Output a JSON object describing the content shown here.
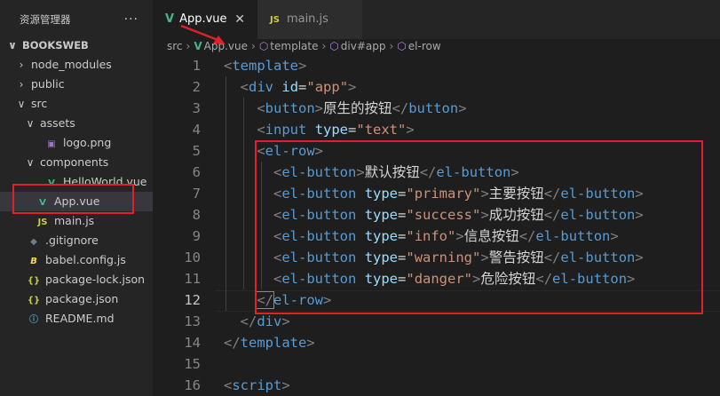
{
  "explorer": {
    "title": "资源管理器",
    "more": "···"
  },
  "tree": [
    {
      "label": "BOOKSWEB",
      "chevron": "∨",
      "icon": "",
      "depth": 0,
      "kind": "project"
    },
    {
      "label": "node_modules",
      "chevron": "›",
      "icon": "",
      "depth": 1,
      "kind": "folder"
    },
    {
      "label": "public",
      "chevron": "›",
      "icon": "",
      "depth": 1,
      "kind": "folder"
    },
    {
      "label": "src",
      "chevron": "∨",
      "icon": "",
      "depth": 1,
      "kind": "folder"
    },
    {
      "label": "assets",
      "chevron": "∨",
      "icon": "",
      "depth": 2,
      "kind": "folder"
    },
    {
      "label": "logo.png",
      "chevron": "",
      "icon": "▣",
      "depth": 3,
      "kind": "img"
    },
    {
      "label": "components",
      "chevron": "∨",
      "icon": "",
      "depth": 2,
      "kind": "folder"
    },
    {
      "label": "HelloWorld.vue",
      "chevron": "",
      "icon": "V",
      "depth": 3,
      "kind": "vue"
    },
    {
      "label": "App.vue",
      "chevron": "",
      "icon": "V",
      "depth": 2,
      "kind": "vue",
      "selected": true
    },
    {
      "label": "main.js",
      "chevron": "",
      "icon": "JS",
      "depth": 2,
      "kind": "js"
    },
    {
      "label": ".gitignore",
      "chevron": "",
      "icon": "◆",
      "depth": 1,
      "kind": "git"
    },
    {
      "label": "babel.config.js",
      "chevron": "",
      "icon": "B",
      "depth": 1,
      "kind": "babel"
    },
    {
      "label": "package-lock.json",
      "chevron": "",
      "icon": "{}",
      "depth": 1,
      "kind": "json"
    },
    {
      "label": "package.json",
      "chevron": "",
      "icon": "{}",
      "depth": 1,
      "kind": "json"
    },
    {
      "label": "README.md",
      "chevron": "",
      "icon": "ⓘ",
      "depth": 1,
      "kind": "info"
    }
  ],
  "tabs": [
    {
      "label": "App.vue",
      "icon": "V",
      "close": "✕"
    },
    {
      "label": "main.js",
      "icon": "JS"
    }
  ],
  "breadcrumb": [
    "src",
    "App.vue",
    "template",
    "div#app",
    "el-row"
  ],
  "breadcrumb_icons": [
    "",
    "V",
    "⬡",
    "⬡",
    "⬡"
  ],
  "code_lines": [
    {
      "n": "1",
      "tokens": [
        [
          "b",
          "<"
        ],
        [
          "t",
          "template"
        ],
        [
          "b",
          ">"
        ]
      ]
    },
    {
      "n": "2",
      "tokens": [
        [
          "tx",
          "  "
        ],
        [
          "b",
          "<"
        ],
        [
          "t",
          "div"
        ],
        [
          "tx",
          " "
        ],
        [
          "a",
          "id"
        ],
        [
          "tx",
          "="
        ],
        [
          "s",
          "\"app\""
        ],
        [
          "b",
          ">"
        ]
      ]
    },
    {
      "n": "3",
      "tokens": [
        [
          "tx",
          "    "
        ],
        [
          "b",
          "<"
        ],
        [
          "t",
          "button"
        ],
        [
          "b",
          ">"
        ],
        [
          "tx",
          "原生的按钮"
        ],
        [
          "b",
          "</"
        ],
        [
          "t",
          "button"
        ],
        [
          "b",
          ">"
        ]
      ]
    },
    {
      "n": "4",
      "tokens": [
        [
          "tx",
          "    "
        ],
        [
          "b",
          "<"
        ],
        [
          "t",
          "input"
        ],
        [
          "tx",
          " "
        ],
        [
          "a",
          "type"
        ],
        [
          "tx",
          "="
        ],
        [
          "s",
          "\"text\""
        ],
        [
          "b",
          ">"
        ]
      ]
    },
    {
      "n": "5",
      "tokens": [
        [
          "tx",
          "    "
        ],
        [
          "b",
          "<"
        ],
        [
          "t",
          "el-row"
        ],
        [
          "b",
          ">"
        ]
      ]
    },
    {
      "n": "6",
      "tokens": [
        [
          "tx",
          "      "
        ],
        [
          "b",
          "<"
        ],
        [
          "t",
          "el-button"
        ],
        [
          "b",
          ">"
        ],
        [
          "tx",
          "默认按钮"
        ],
        [
          "b",
          "</"
        ],
        [
          "t",
          "el-button"
        ],
        [
          "b",
          ">"
        ]
      ]
    },
    {
      "n": "7",
      "tokens": [
        [
          "tx",
          "      "
        ],
        [
          "b",
          "<"
        ],
        [
          "t",
          "el-button"
        ],
        [
          "tx",
          " "
        ],
        [
          "a",
          "type"
        ],
        [
          "tx",
          "="
        ],
        [
          "s",
          "\"primary\""
        ],
        [
          "b",
          ">"
        ],
        [
          "tx",
          "主要按钮"
        ],
        [
          "b",
          "</"
        ],
        [
          "t",
          "el-button"
        ],
        [
          "b",
          ">"
        ]
      ]
    },
    {
      "n": "8",
      "tokens": [
        [
          "tx",
          "      "
        ],
        [
          "b",
          "<"
        ],
        [
          "t",
          "el-button"
        ],
        [
          "tx",
          " "
        ],
        [
          "a",
          "type"
        ],
        [
          "tx",
          "="
        ],
        [
          "s",
          "\"success\""
        ],
        [
          "b",
          ">"
        ],
        [
          "tx",
          "成功按钮"
        ],
        [
          "b",
          "</"
        ],
        [
          "t",
          "el-button"
        ],
        [
          "b",
          ">"
        ]
      ]
    },
    {
      "n": "9",
      "tokens": [
        [
          "tx",
          "      "
        ],
        [
          "b",
          "<"
        ],
        [
          "t",
          "el-button"
        ],
        [
          "tx",
          " "
        ],
        [
          "a",
          "type"
        ],
        [
          "tx",
          "="
        ],
        [
          "s",
          "\"info\""
        ],
        [
          "b",
          ">"
        ],
        [
          "tx",
          "信息按钮"
        ],
        [
          "b",
          "</"
        ],
        [
          "t",
          "el-button"
        ],
        [
          "b",
          ">"
        ]
      ]
    },
    {
      "n": "10",
      "tokens": [
        [
          "tx",
          "      "
        ],
        [
          "b",
          "<"
        ],
        [
          "t",
          "el-button"
        ],
        [
          "tx",
          " "
        ],
        [
          "a",
          "type"
        ],
        [
          "tx",
          "="
        ],
        [
          "s",
          "\"warning\""
        ],
        [
          "b",
          ">"
        ],
        [
          "tx",
          "警告按钮"
        ],
        [
          "b",
          "</"
        ],
        [
          "t",
          "el-button"
        ],
        [
          "b",
          ">"
        ]
      ]
    },
    {
      "n": "11",
      "tokens": [
        [
          "tx",
          "      "
        ],
        [
          "b",
          "<"
        ],
        [
          "t",
          "el-button"
        ],
        [
          "tx",
          " "
        ],
        [
          "a",
          "type"
        ],
        [
          "tx",
          "="
        ],
        [
          "s",
          "\"danger\""
        ],
        [
          "b",
          ">"
        ],
        [
          "tx",
          "危险按钮"
        ],
        [
          "b",
          "</"
        ],
        [
          "t",
          "el-button"
        ],
        [
          "b",
          ">"
        ]
      ]
    },
    {
      "n": "12",
      "tokens": [
        [
          "tx",
          "    "
        ],
        [
          "b",
          "</"
        ],
        [
          "t",
          "el-row"
        ],
        [
          "b",
          ">"
        ]
      ],
      "active": true
    },
    {
      "n": "13",
      "tokens": [
        [
          "tx",
          "  "
        ],
        [
          "b",
          "</"
        ],
        [
          "t",
          "div"
        ],
        [
          "b",
          ">"
        ]
      ]
    },
    {
      "n": "14",
      "tokens": [
        [
          "b",
          "</"
        ],
        [
          "t",
          "template"
        ],
        [
          "b",
          ">"
        ]
      ]
    },
    {
      "n": "15",
      "tokens": []
    },
    {
      "n": "16",
      "tokens": [
        [
          "b",
          "<"
        ],
        [
          "t",
          "script"
        ],
        [
          "b",
          ">"
        ]
      ]
    }
  ],
  "colors": {
    "annotation": "#e0202a",
    "vue": "#41b883",
    "js": "#cbcb41"
  }
}
